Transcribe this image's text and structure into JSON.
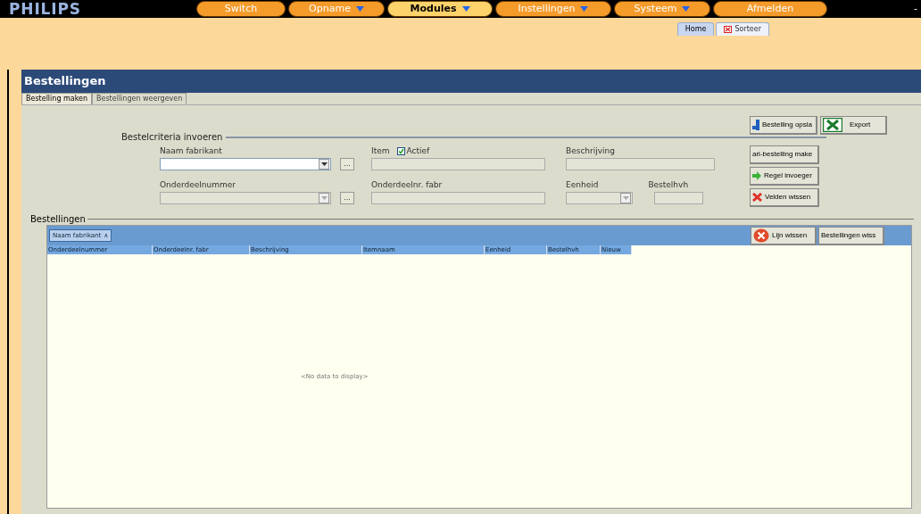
{
  "logo": "PHILIPS",
  "menu": [
    {
      "label": "Switch",
      "dropdown": false,
      "selected": false
    },
    {
      "label": "Opname",
      "dropdown": true,
      "selected": false
    },
    {
      "label": "Modules",
      "dropdown": true,
      "selected": true
    },
    {
      "label": "Instellingen",
      "dropdown": true,
      "selected": false
    },
    {
      "label": "Systeem",
      "dropdown": true,
      "selected": false
    },
    {
      "label": "Afmelden",
      "dropdown": false,
      "selected": false
    }
  ],
  "window_control": "-",
  "page_tabs": [
    {
      "label": "Home",
      "selected": true,
      "icon": false
    },
    {
      "label": "Sorteer",
      "selected": false,
      "icon": true
    }
  ],
  "panel": {
    "title": "Bestellingen",
    "tabs": [
      {
        "label": "Bestelling maken",
        "selected": true
      },
      {
        "label": "Bestellingen weergeven",
        "selected": false
      }
    ],
    "criteria": {
      "legend": "Bestelcriteria invoeren",
      "item_label": "Item",
      "actief": {
        "label": "Actief",
        "checked": true
      },
      "fields": [
        {
          "label": "Naam fabrikant",
          "kind": "combo",
          "disabled": false,
          "lookup": true
        },
        {
          "label": "Beschrijving",
          "kind": "text",
          "disabled": true
        },
        {
          "label": "Onderdeelnummer",
          "kind": "combo",
          "disabled": true,
          "lookup": true
        },
        {
          "label": "Onderdeelnr. fabr",
          "kind": "text",
          "disabled": true
        },
        {
          "label": "Eenheid",
          "kind": "combo",
          "disabled": true,
          "lookup": false
        },
        {
          "label": "Bestelhvh",
          "kind": "text",
          "disabled": true
        }
      ],
      "lookup_label": "..."
    },
    "actions": [
      {
        "label": "Bestelling opsla",
        "kind": "save"
      },
      {
        "label": "Export",
        "kind": "excel"
      },
      {
        "label": "ari-bestelling make",
        "kind": "plain"
      },
      {
        "label": "Regel invoeger",
        "kind": "add"
      },
      {
        "label": "Velden wissen",
        "kind": "clear"
      }
    ],
    "orders": {
      "legend": "Bestellingen",
      "group_by": "Naam fabrikant",
      "group_sort": "∧",
      "buttons": [
        {
          "label": "Lijn wissen",
          "kind": "delete"
        },
        {
          "label": "Bestellingen wiss",
          "kind": "plain"
        }
      ],
      "columns": [
        "Onderdeelnummer",
        "Onderdeelnr. fabr",
        "Beschrijving",
        "Itemnaam",
        "Eenheid",
        "Bestelhvh",
        "Nieuw"
      ],
      "empty": "<No data to display>"
    }
  }
}
